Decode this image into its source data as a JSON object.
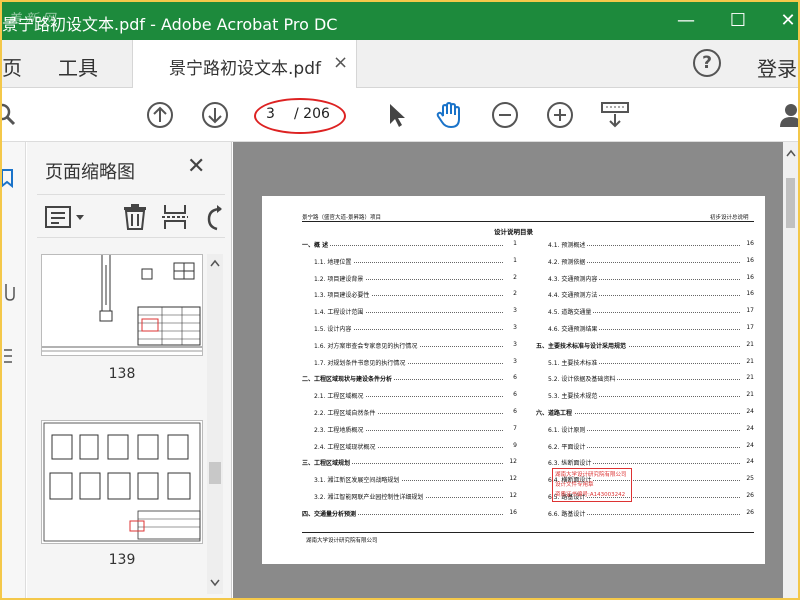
{
  "window": {
    "title": "景宁路初设文本.pdf - Adobe Acrobat Pro DC",
    "watermark": "美 新 网",
    "minimize": "—",
    "maximize": "☐",
    "close": "✕"
  },
  "tabs": {
    "home_label": "页",
    "tools_label": "工具",
    "doc_tab_label": "景宁路初设文本.pdf",
    "doc_tab_close": "×",
    "help_label": "?",
    "login_label": "登录"
  },
  "toolbar": {
    "current_page": "3",
    "total_pages": "/ 206"
  },
  "thumbnails": {
    "panel_title": "页面缩略图",
    "close": "✕",
    "items": [
      {
        "label": "138"
      },
      {
        "label": "139"
      }
    ]
  },
  "document": {
    "header_left": "景宁路（盛官大道-景昇路）项目",
    "header_right": "初步设计总说明",
    "title": "设计说明目录",
    "footer": "湖南大学设计研究院有限公司",
    "stamp_lines": [
      "湖南大学设计研究院有限公司",
      "设计文件专用章",
      "资质证书编号:A143003242"
    ],
    "toc_left": [
      {
        "text": "一、概  述",
        "page": "1",
        "sec": true
      },
      {
        "text": "1.1. 地理位置",
        "page": "1",
        "sec": false
      },
      {
        "text": "1.2. 项目建设背景",
        "page": "2",
        "sec": false
      },
      {
        "text": "1.3. 项目建设必要性",
        "page": "2",
        "sec": false
      },
      {
        "text": "1.4. 工程设计范围",
        "page": "3",
        "sec": false
      },
      {
        "text": "1.5. 设计内容",
        "page": "3",
        "sec": false
      },
      {
        "text": "1.6. 对方案审查会专家意见的执行情况",
        "page": "3",
        "sec": false
      },
      {
        "text": "1.7. 对规划条件书意见的执行情况",
        "page": "3",
        "sec": false
      },
      {
        "text": "二、工程区域现状与建设条件分析",
        "page": "6",
        "sec": true
      },
      {
        "text": "2.1. 工程区域概况",
        "page": "6",
        "sec": false
      },
      {
        "text": "2.2. 工程区域自然条件",
        "page": "6",
        "sec": false
      },
      {
        "text": "2.3. 工程地质概况",
        "page": "7",
        "sec": false
      },
      {
        "text": "2.4. 工程区域现状概况",
        "page": "9",
        "sec": false
      },
      {
        "text": "三、工程区域规划",
        "page": "12",
        "sec": true
      },
      {
        "text": "3.1. 湘江新区发展空间战略规划",
        "page": "12",
        "sec": false
      },
      {
        "text": "3.2. 湘江智能网联产业园控制性详细规划",
        "page": "12",
        "sec": false
      },
      {
        "text": "四、交通量分析预测",
        "page": "16",
        "sec": true
      }
    ],
    "toc_right": [
      {
        "text": "4.1. 预测概述",
        "page": "16",
        "sec": false
      },
      {
        "text": "4.2. 预测依据",
        "page": "16",
        "sec": false
      },
      {
        "text": "4.3. 交通预测内容",
        "page": "16",
        "sec": false
      },
      {
        "text": "4.4. 交通预测方法",
        "page": "16",
        "sec": false
      },
      {
        "text": "4.5. 道路交通量",
        "page": "17",
        "sec": false
      },
      {
        "text": "4.6. 交通预测结果",
        "page": "17",
        "sec": false
      },
      {
        "text": "五、主要技术标准与设计采用规范",
        "page": "21",
        "sec": true
      },
      {
        "text": "5.1. 主要技术标准",
        "page": "21",
        "sec": false
      },
      {
        "text": "5.2. 设计依据及基础资料",
        "page": "21",
        "sec": false
      },
      {
        "text": "5.3. 主要技术规范",
        "page": "21",
        "sec": false
      },
      {
        "text": "六、道路工程",
        "page": "24",
        "sec": true
      },
      {
        "text": "6.1. 设计原则",
        "page": "24",
        "sec": false
      },
      {
        "text": "6.2. 平面设计",
        "page": "24",
        "sec": false
      },
      {
        "text": "6.3. 纵断面设计",
        "page": "24",
        "sec": false
      },
      {
        "text": "6.4. 横断面设计",
        "page": "25",
        "sec": false
      },
      {
        "text": "6.5. 路基设计",
        "page": "26",
        "sec": false
      },
      {
        "text": "6.6. 路基设计",
        "page": "26",
        "sec": false
      }
    ]
  }
}
